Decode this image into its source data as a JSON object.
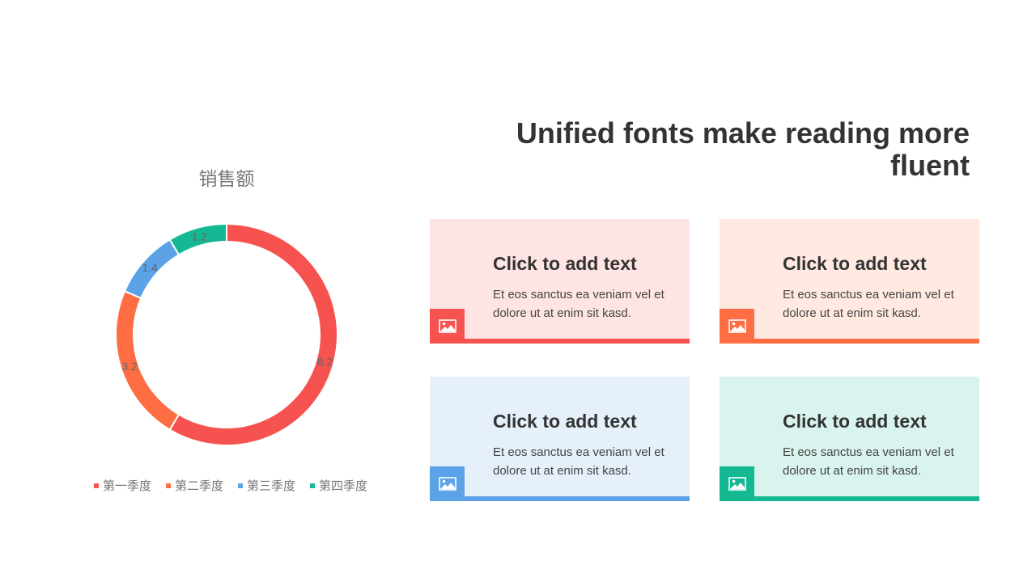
{
  "chart_data": {
    "type": "pie",
    "title": "销售额",
    "categories": [
      "第一季度",
      "第二季度",
      "第三季度",
      "第四季度"
    ],
    "values": [
      8.2,
      3.2,
      1.4,
      1.2
    ],
    "colors": [
      "#f65250",
      "#ff6d42",
      "#5ba2e6",
      "#14b893"
    ],
    "donut": true,
    "legend": "bottom"
  },
  "headline": "Unified fonts make reading more fluent",
  "cards": [
    {
      "title": "Click to add text",
      "body": "Et eos sanctus ea veniam vel et dolore ut at enim sit kasd.",
      "bg": "#ffe4e4",
      "accent": "#f65250",
      "icon": "image-icon"
    },
    {
      "title": "Click to add text",
      "body": "Et eos sanctus ea veniam vel et dolore ut at enim sit kasd.",
      "bg": "#ffe9e1",
      "accent": "#ff6d42",
      "icon": "image-icon"
    },
    {
      "title": "Click to add text",
      "body": "Et eos sanctus ea veniam vel et dolore ut at enim sit kasd.",
      "bg": "#e6f0fb",
      "accent": "#5ba2e6",
      "icon": "image-icon"
    },
    {
      "title": "Click to add text",
      "body": "Et eos sanctus ea veniam vel et dolore ut at enim sit kasd.",
      "bg": "#d9f4ee",
      "accent": "#14b893",
      "icon": "image-icon"
    }
  ]
}
